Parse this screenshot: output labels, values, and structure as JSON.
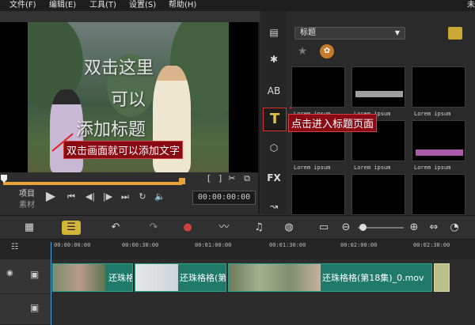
{
  "menu": [
    "文件(F)",
    "编辑(E)",
    "工具(T)",
    "设置(S)",
    "帮助(H)"
  ],
  "menu_cut": "未",
  "preview": {
    "overlay_lines": [
      "双击这里",
      "可以",
      "添加标题"
    ],
    "note_video": "双击画面就可以添加文字",
    "note_library": "点击进入标题页面",
    "mode_project": "项目",
    "mode_clip": "素材",
    "timecode": "00:00:00:00",
    "bracket_in": "[",
    "bracket_out": "]"
  },
  "library": {
    "category": "标题",
    "thumbnail_caption": "Lorem ipsum",
    "side_icons": [
      "media-icon",
      "instant-project-icon",
      "transition-icon",
      "title-icon",
      "graphic-icon",
      "filter-icon",
      "path-icon"
    ],
    "side_fx_label": "FX",
    "side_title_label": "T",
    "side_ab_label": "AB",
    "accent_bars": [
      "#9e9e9e",
      "#a85aa8"
    ]
  },
  "timeline": {
    "ruler_ticks": [
      "00:00:00:00",
      "00:00:30:00",
      "00:01:00:00",
      "00:01:30:00",
      "00:02:00:00",
      "00:02:30:00"
    ],
    "clips": [
      "还珠格格",
      "还珠格格(第",
      "还珠格格(第18集)_0.mov"
    ]
  },
  "colors": {
    "accent_yellow": "#d4b53a",
    "clip_teal": "#1f7a6a",
    "annotation_red": "#d83030",
    "scrubber_orange": "#e9a23b"
  }
}
